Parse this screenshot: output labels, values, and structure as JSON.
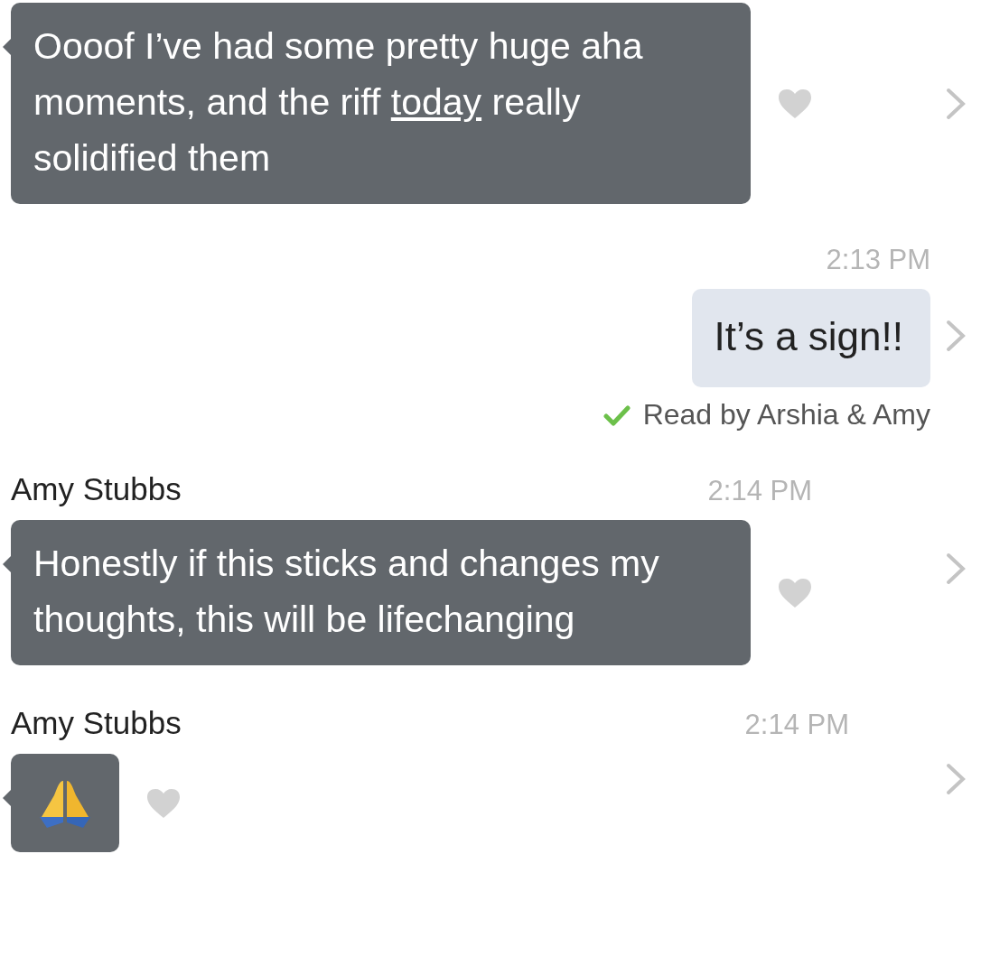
{
  "messages": [
    {
      "kind": "received",
      "segments": [
        {
          "text": "Oooof I’ve had some pretty huge aha moments, and the riff "
        },
        {
          "text": "today",
          "kind": "link"
        },
        {
          "text": " really solidified them"
        }
      ]
    },
    {
      "kind": "sent",
      "time": "2:13 PM",
      "text": "It’s a sign!!",
      "receipt": "Read by Arshia & Amy"
    },
    {
      "kind": "received",
      "sender": "Amy Stubbs",
      "time": "2:14 PM",
      "segments": [
        {
          "text": "Honestly if this sticks and changes my thoughts, this will be lifechanging"
        }
      ]
    },
    {
      "kind": "emoji",
      "sender": "Amy Stubbs",
      "time": "2:14 PM"
    }
  ]
}
